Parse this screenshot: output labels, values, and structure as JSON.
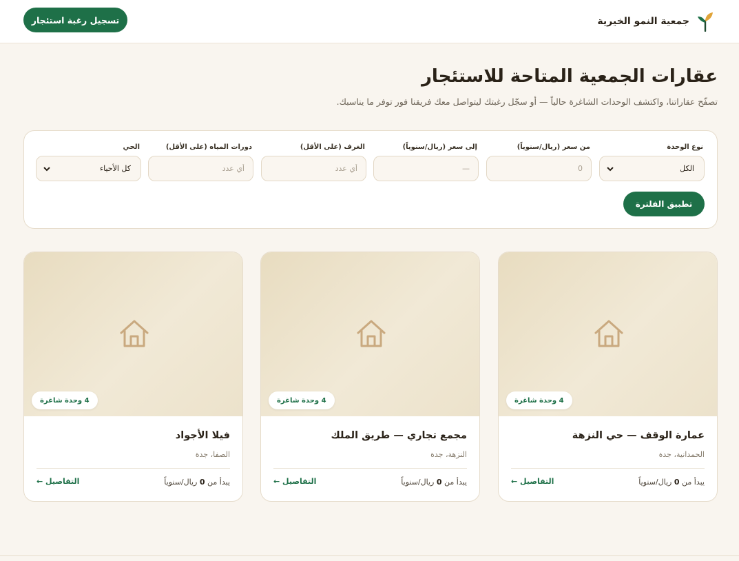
{
  "header": {
    "brand_name": "جمعية النمو الخيرية",
    "cta_label": "تسجيل رغبة استئجار",
    "accent": "#1e7048"
  },
  "hero": {
    "title": "عقارات الجمعية المتاحة للاستئجار",
    "subtitle": "تصفّح عقاراتنا، واكتشف الوحدات الشاغرة حالياً — أو سجّل رغبتك ليتواصل معك فريقنا فور توفر ما يناسبك."
  },
  "filters": {
    "unit_type": {
      "label": "نوع الوحدة",
      "value": "الكل"
    },
    "price_from": {
      "label": "من سعر (ريال/سنوياً)",
      "placeholder": "0"
    },
    "price_to": {
      "label": "إلى سعر (ريال/سنوياً)",
      "placeholder": "—"
    },
    "rooms": {
      "label": "الغرف (على الأقل)",
      "placeholder": "أي عدد"
    },
    "bathrooms": {
      "label": "دورات المياه (على الأقل)",
      "placeholder": "أي عدد"
    },
    "district": {
      "label": "الحي",
      "value": "كل الأحياء"
    },
    "apply_label": "تطبيق الفلترة"
  },
  "properties": [
    {
      "title": "عمارة الوقف — حي النزهة",
      "location": "الحمدانية، جدة",
      "badge": "4 وحدة شاغرة",
      "price_prefix": "يبدأ من",
      "price_value": "0",
      "price_unit": "ريال/سنوياً",
      "details_label": "التفاصيل ←"
    },
    {
      "title": "مجمع تجاري — طريق الملك",
      "location": "النزهة، جدة",
      "badge": "4 وحدة شاغرة",
      "price_prefix": "يبدأ من",
      "price_value": "0",
      "price_unit": "ريال/سنوياً",
      "details_label": "التفاصيل ←"
    },
    {
      "title": "فيلا الأجواد",
      "location": "الصفا، جدة",
      "badge": "4 وحدة شاغرة",
      "price_prefix": "يبدأ من",
      "price_value": "0",
      "price_unit": "ريال/سنوياً",
      "details_label": "التفاصيل ←"
    }
  ]
}
